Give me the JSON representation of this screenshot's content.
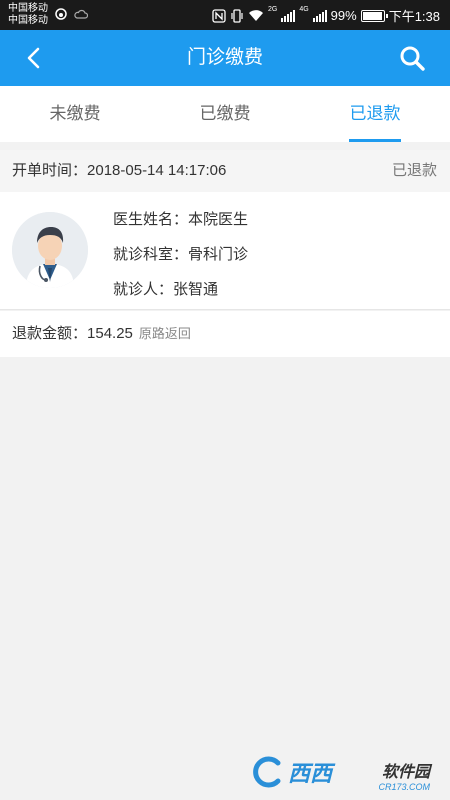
{
  "status_bar": {
    "carrier_1": "中国移动",
    "carrier_2": "中国移动",
    "battery_pct": "99%",
    "time": "下午1:38",
    "net_1": "2G",
    "net_2": "4G",
    "battery_level": 0.99
  },
  "appbar": {
    "title": "门诊缴费",
    "back_icon": "chevron-left-icon",
    "search_icon": "search-icon"
  },
  "tabs": [
    {
      "label": "未缴费",
      "active": false
    },
    {
      "label": "已缴费",
      "active": false
    },
    {
      "label": "已退款",
      "active": true
    }
  ],
  "record": {
    "open_time_label": "开单时间：",
    "open_time_value": "2018-05-14 14:17:06",
    "status": "已退款",
    "doctor_label": "医生姓名：",
    "doctor_value": "本院医生",
    "dept_label": "就诊科室：",
    "dept_value": "骨科门诊",
    "patient_label": "就诊人：",
    "patient_value": "张智通",
    "refund_label": "退款金额：",
    "refund_value": "154.25",
    "refund_way": "原路返回"
  },
  "watermark": {
    "brand": "西西",
    "name": "软件园",
    "site": "CR173.COM"
  },
  "colors": {
    "primary": "#1e9bef",
    "statusbar": "#1a1a1a"
  }
}
